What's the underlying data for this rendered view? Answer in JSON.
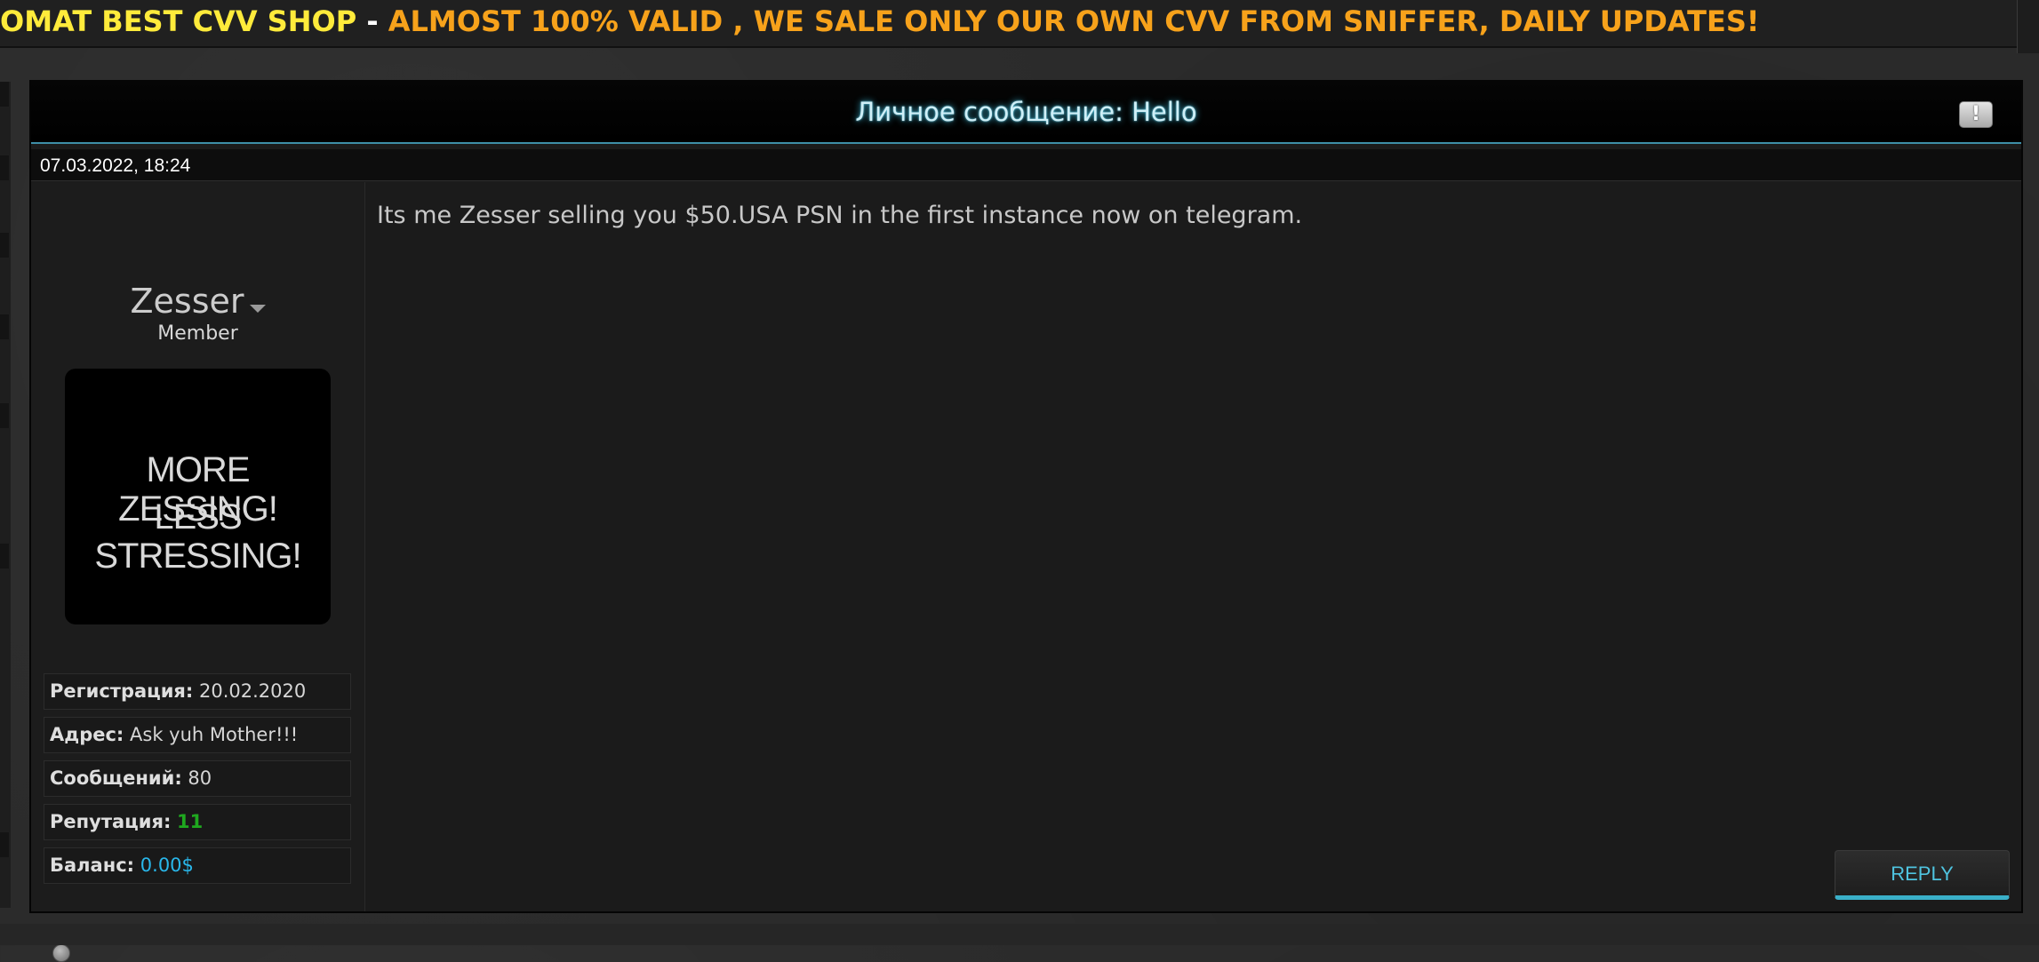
{
  "banner": {
    "shop": "OMAT BEST CVV SHOP",
    "dash": " - ",
    "rest": "ALMOST 100% VALID , WE SALE ONLY OUR OWN CVV FROM SNIFFER, DAILY UPDATES!"
  },
  "message": {
    "title": "Личное сообщение: Hello",
    "date": "07.03.2022, 18:24",
    "body": "Its me Zesser selling you $50.USA PSN in the first instance now on telegram.",
    "reply_label": "REPLY"
  },
  "user": {
    "name": "Zesser",
    "role": "Member",
    "avatar_lines": [
      "MORE ZESSING!",
      "LESS STRESSING!"
    ],
    "info": {
      "registration_label": "Регистрация:",
      "registration_value": "20.02.2020",
      "address_label": "Адрес:",
      "address_value": "Ask yuh Mother!!!",
      "posts_label": "Сообщений:",
      "posts_value": "80",
      "reputation_label": "Репутация:",
      "reputation_value": "11",
      "balance_label": "Баланс:",
      "balance_value": "0.00$"
    },
    "status": "offline"
  },
  "icons": {
    "report": "report-icon",
    "user_menu": "chevron-down-icon",
    "status": "status-dot-icon"
  },
  "colors": {
    "banner_shop": "#ffeb3b",
    "banner_rest": "#f7a21b",
    "accent": "#3ab0c9",
    "reputation": "#1fa81f",
    "balance": "#29b7ea"
  }
}
